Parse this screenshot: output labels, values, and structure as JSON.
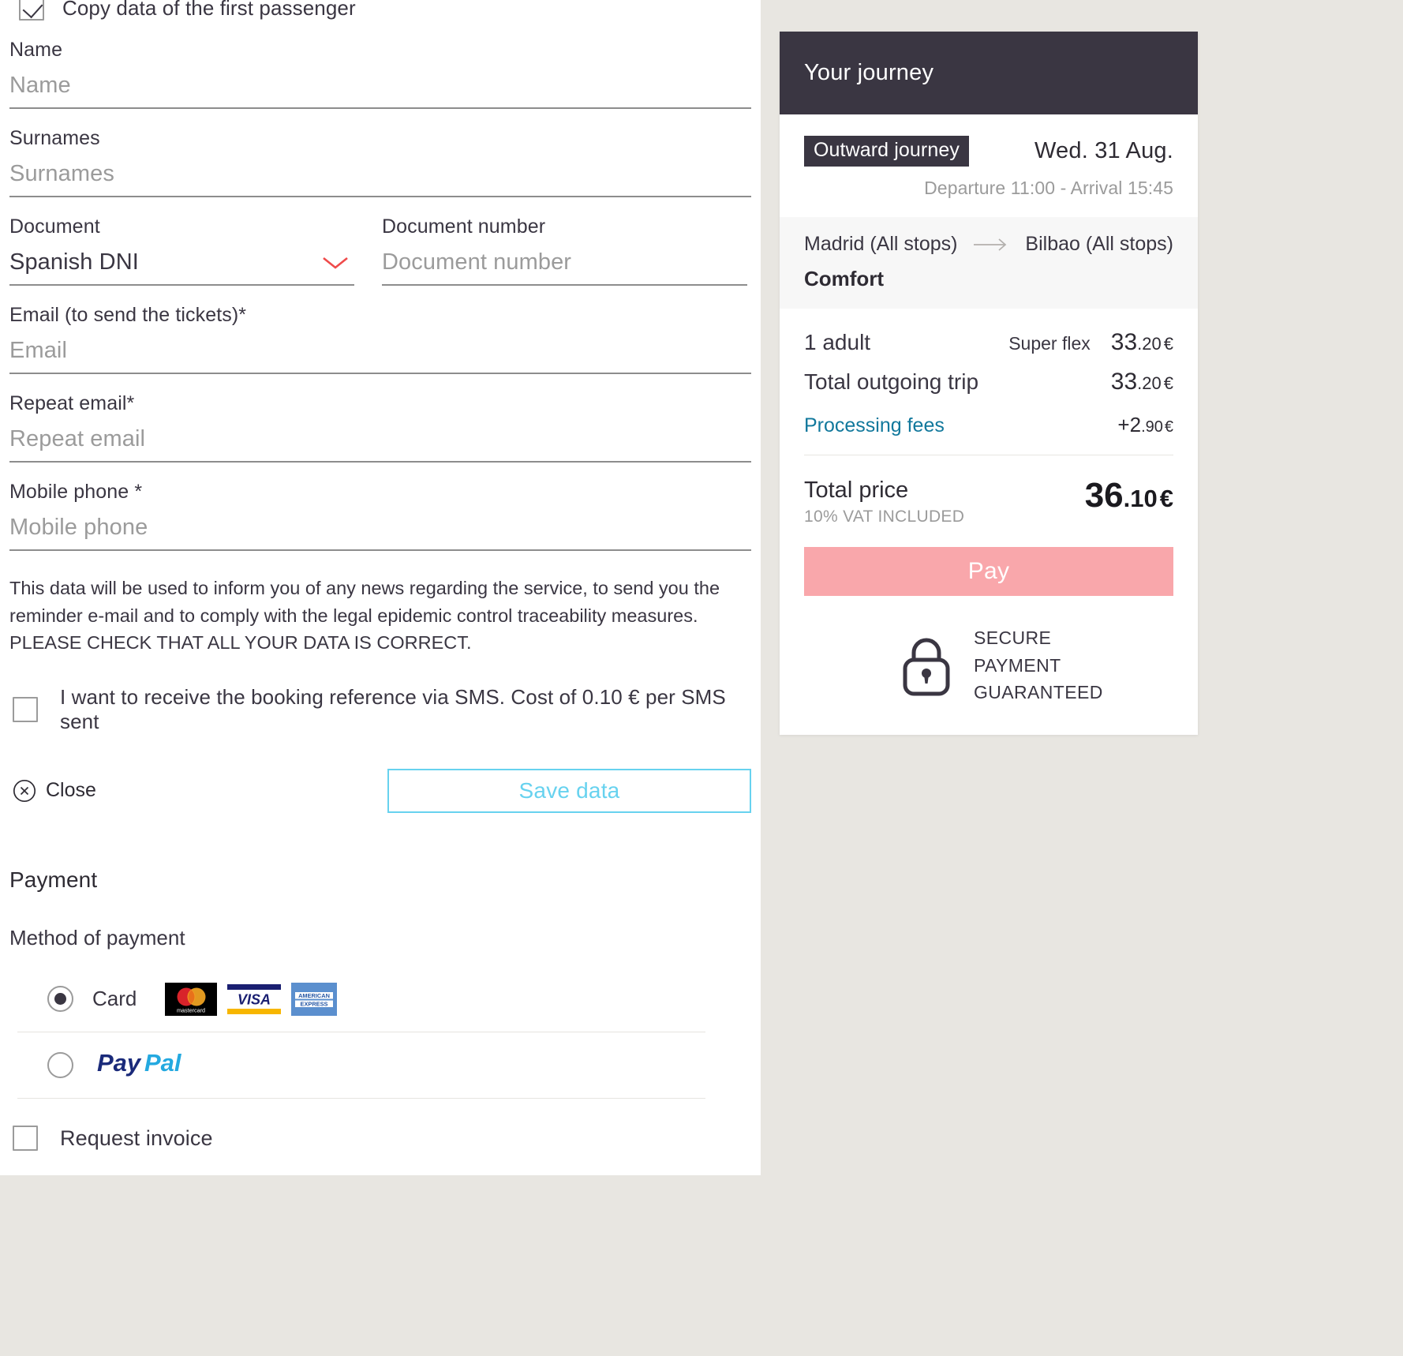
{
  "passenger_form": {
    "copy_first_passenger": {
      "label": "Copy data of the first passenger",
      "checked": true
    },
    "fields": [
      {
        "label": "Name",
        "placeholder": "Name",
        "value": ""
      },
      {
        "label": "Surnames",
        "placeholder": "Surnames",
        "value": ""
      }
    ],
    "document": {
      "label": "Document",
      "selected": "Spanish DNI"
    },
    "document_number": {
      "label": "Document number",
      "placeholder": "Document number",
      "value": ""
    },
    "email": {
      "label": "Email (to send the tickets)*",
      "placeholder": "Email",
      "value": ""
    },
    "repeat_email": {
      "label": "Repeat email*",
      "placeholder": "Repeat email",
      "value": ""
    },
    "mobile_phone": {
      "label": "Mobile phone *",
      "placeholder": "Mobile phone",
      "value": ""
    },
    "disclaimer": "This data will be used to inform you of any news regarding the service, to send you the reminder e-mail and to comply with the legal epidemic control traceability measures. PLEASE CHECK THAT ALL YOUR DATA IS CORRECT.",
    "sms_option": {
      "label": "I want to receive the booking reference via SMS. Cost of 0.10 € per SMS sent",
      "checked": false
    },
    "close_label": "Close",
    "save_label": "Save data"
  },
  "payment": {
    "title": "Payment",
    "method_label": "Method of payment",
    "methods": [
      {
        "id": "card",
        "label": "Card",
        "selected": true,
        "logos": [
          "mastercard",
          "visa",
          "american-express"
        ]
      },
      {
        "id": "paypal",
        "label": "PayPal",
        "selected": false,
        "logos": [
          "paypal"
        ]
      }
    ],
    "request_invoice": {
      "label": "Request invoice",
      "checked": false
    }
  },
  "summary": {
    "title": "Your journey",
    "journey": {
      "badge": "Outward journey",
      "date": "Wed. 31 Aug.",
      "times": "Departure 11:00 - Arrival 15:45",
      "origin": "Madrid (All stops)",
      "destination": "Bilbao (All stops)",
      "travel_class": "Comfort"
    },
    "price_rows": [
      {
        "label": "1 adult",
        "fare": "Super flex",
        "amount_int": "33",
        "amount_dec": ".20",
        "currency": "€"
      },
      {
        "label": "Total outgoing trip",
        "fare": "",
        "amount_int": "33",
        "amount_dec": ".20",
        "currency": "€"
      }
    ],
    "processing_fees": {
      "label": "Processing fees",
      "amount_int": "+2",
      "amount_dec": ".90",
      "currency": "€"
    },
    "total": {
      "label": "Total price",
      "vat_note": "10% VAT INCLUDED",
      "amount_int": "36",
      "amount_dec": ".10",
      "currency": "€"
    },
    "pay_button": "Pay",
    "secure": {
      "line1": "SECURE",
      "line2": "PAYMENT",
      "line3": "GUARANTEED"
    }
  },
  "colors": {
    "dark": "#3a3642",
    "accent_pink": "#f9a7ab",
    "accent_cyan": "#67d2ef",
    "link_blue": "#11789c",
    "chevron_red": "#ef4a4a",
    "page_bg": "#e8e6e1"
  }
}
